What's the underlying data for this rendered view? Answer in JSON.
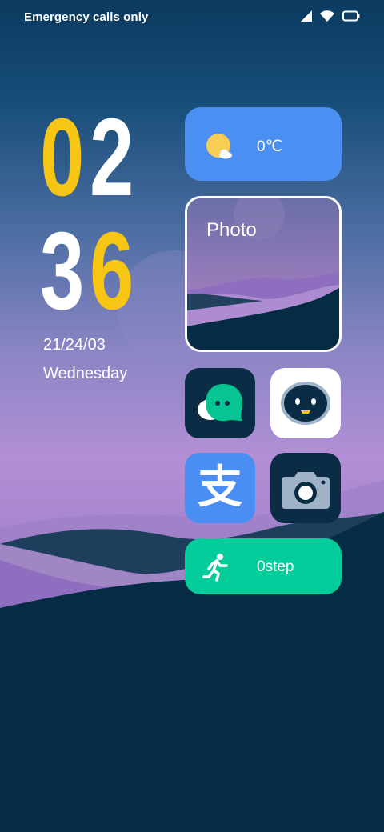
{
  "status_bar": {
    "carrier_text": "Emergency calls only",
    "icons": [
      "signal-icon",
      "wifi-icon",
      "battery-icon"
    ]
  },
  "clock": {
    "hour_tens": "0",
    "hour_ones": "2",
    "minute_tens": "3",
    "minute_ones": "6",
    "accent_color": "#f7c614"
  },
  "date": {
    "date_text": "21/24/03",
    "weekday": "Wednesday"
  },
  "widgets": {
    "weather": {
      "temperature": "0℃",
      "icon": "partly-cloudy-icon",
      "color": "#4b8ff3"
    },
    "photo": {
      "label": "Photo"
    },
    "steps": {
      "text": "0step",
      "icon": "running-icon",
      "color": "#05cc9b"
    }
  },
  "apps": [
    {
      "icon": "chat-icon"
    },
    {
      "icon": "robot-assistant-icon"
    },
    {
      "icon": "alipay-icon",
      "glyph": "支"
    },
    {
      "icon": "camera-icon"
    }
  ]
}
